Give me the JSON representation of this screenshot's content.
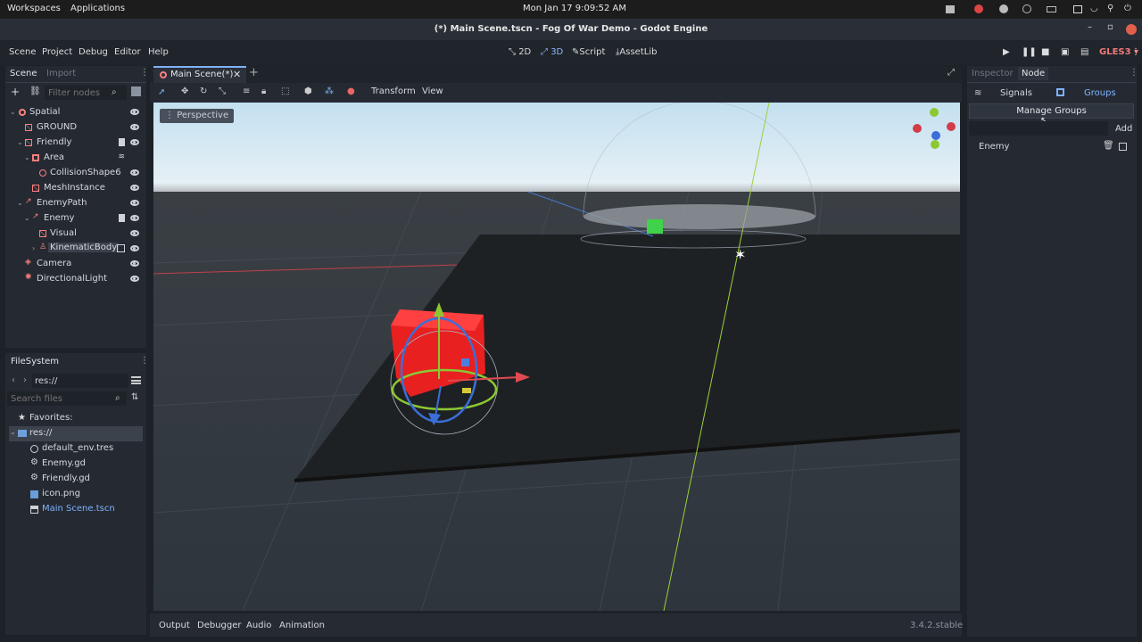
{
  "topbar": {
    "workspaces": "Workspaces",
    "applications": "Applications",
    "datetime": "Mon Jan 17   9:09:52 AM"
  },
  "window": {
    "title": "(*) Main Scene.tscn - Fog Of War Demo - Godot Engine"
  },
  "menu": {
    "items": [
      "Scene",
      "Project",
      "Debug",
      "Editor",
      "Help"
    ]
  },
  "workspaces": {
    "mode_2d": "2D",
    "mode_3d": "3D",
    "script": "Script",
    "assetlib": "AssetLib",
    "renderer": "GLES3"
  },
  "scene_dock": {
    "tabs": [
      "Scene",
      "Import"
    ],
    "filter_placeholder": "Filter nodes",
    "nodes": [
      {
        "label": "Spatial",
        "depth": 0,
        "color": "#fc7f7f"
      },
      {
        "label": "GROUND",
        "depth": 1,
        "color": "#fc7f7f"
      },
      {
        "label": "Friendly",
        "depth": 1,
        "color": "#fc7f7f"
      },
      {
        "label": "Area",
        "depth": 2,
        "color": "#fc7f7f"
      },
      {
        "label": "CollisionShape6",
        "depth": 3,
        "color": "#fc7f7f"
      },
      {
        "label": "MeshInstance",
        "depth": 2,
        "color": "#fc7f7f"
      },
      {
        "label": "EnemyPath",
        "depth": 1,
        "color": "#fc7f7f"
      },
      {
        "label": "Enemy",
        "depth": 2,
        "color": "#fc7f7f"
      },
      {
        "label": "Visual",
        "depth": 3,
        "color": "#fc7f7f"
      },
      {
        "label": "KinematicBody",
        "depth": 3,
        "color": "#fc7f7f"
      },
      {
        "label": "Camera",
        "depth": 1,
        "color": "#fc7f7f"
      },
      {
        "label": "DirectionalLight",
        "depth": 1,
        "color": "#fc7f7f"
      }
    ]
  },
  "filesystem": {
    "title": "FileSystem",
    "path": "res://",
    "search_placeholder": "Search files",
    "favorites": "Favorites:",
    "root": "res://",
    "files": [
      "default_env.tres",
      "Enemy.gd",
      "Friendly.gd",
      "icon.png",
      "Main Scene.tscn"
    ]
  },
  "editor": {
    "tab": "Main Scene(*)",
    "transform": "Transform",
    "view": "View",
    "perspective": "Perspective"
  },
  "bottom": {
    "tabs": [
      "Output",
      "Debugger",
      "Audio",
      "Animation"
    ],
    "version": "3.4.2.stable"
  },
  "inspector": {
    "tabs": [
      "Inspector",
      "Node"
    ],
    "signals": "Signals",
    "groups": "Groups",
    "manage_groups": "Manage Groups",
    "add": "Add",
    "group_items": [
      "Enemy"
    ]
  }
}
